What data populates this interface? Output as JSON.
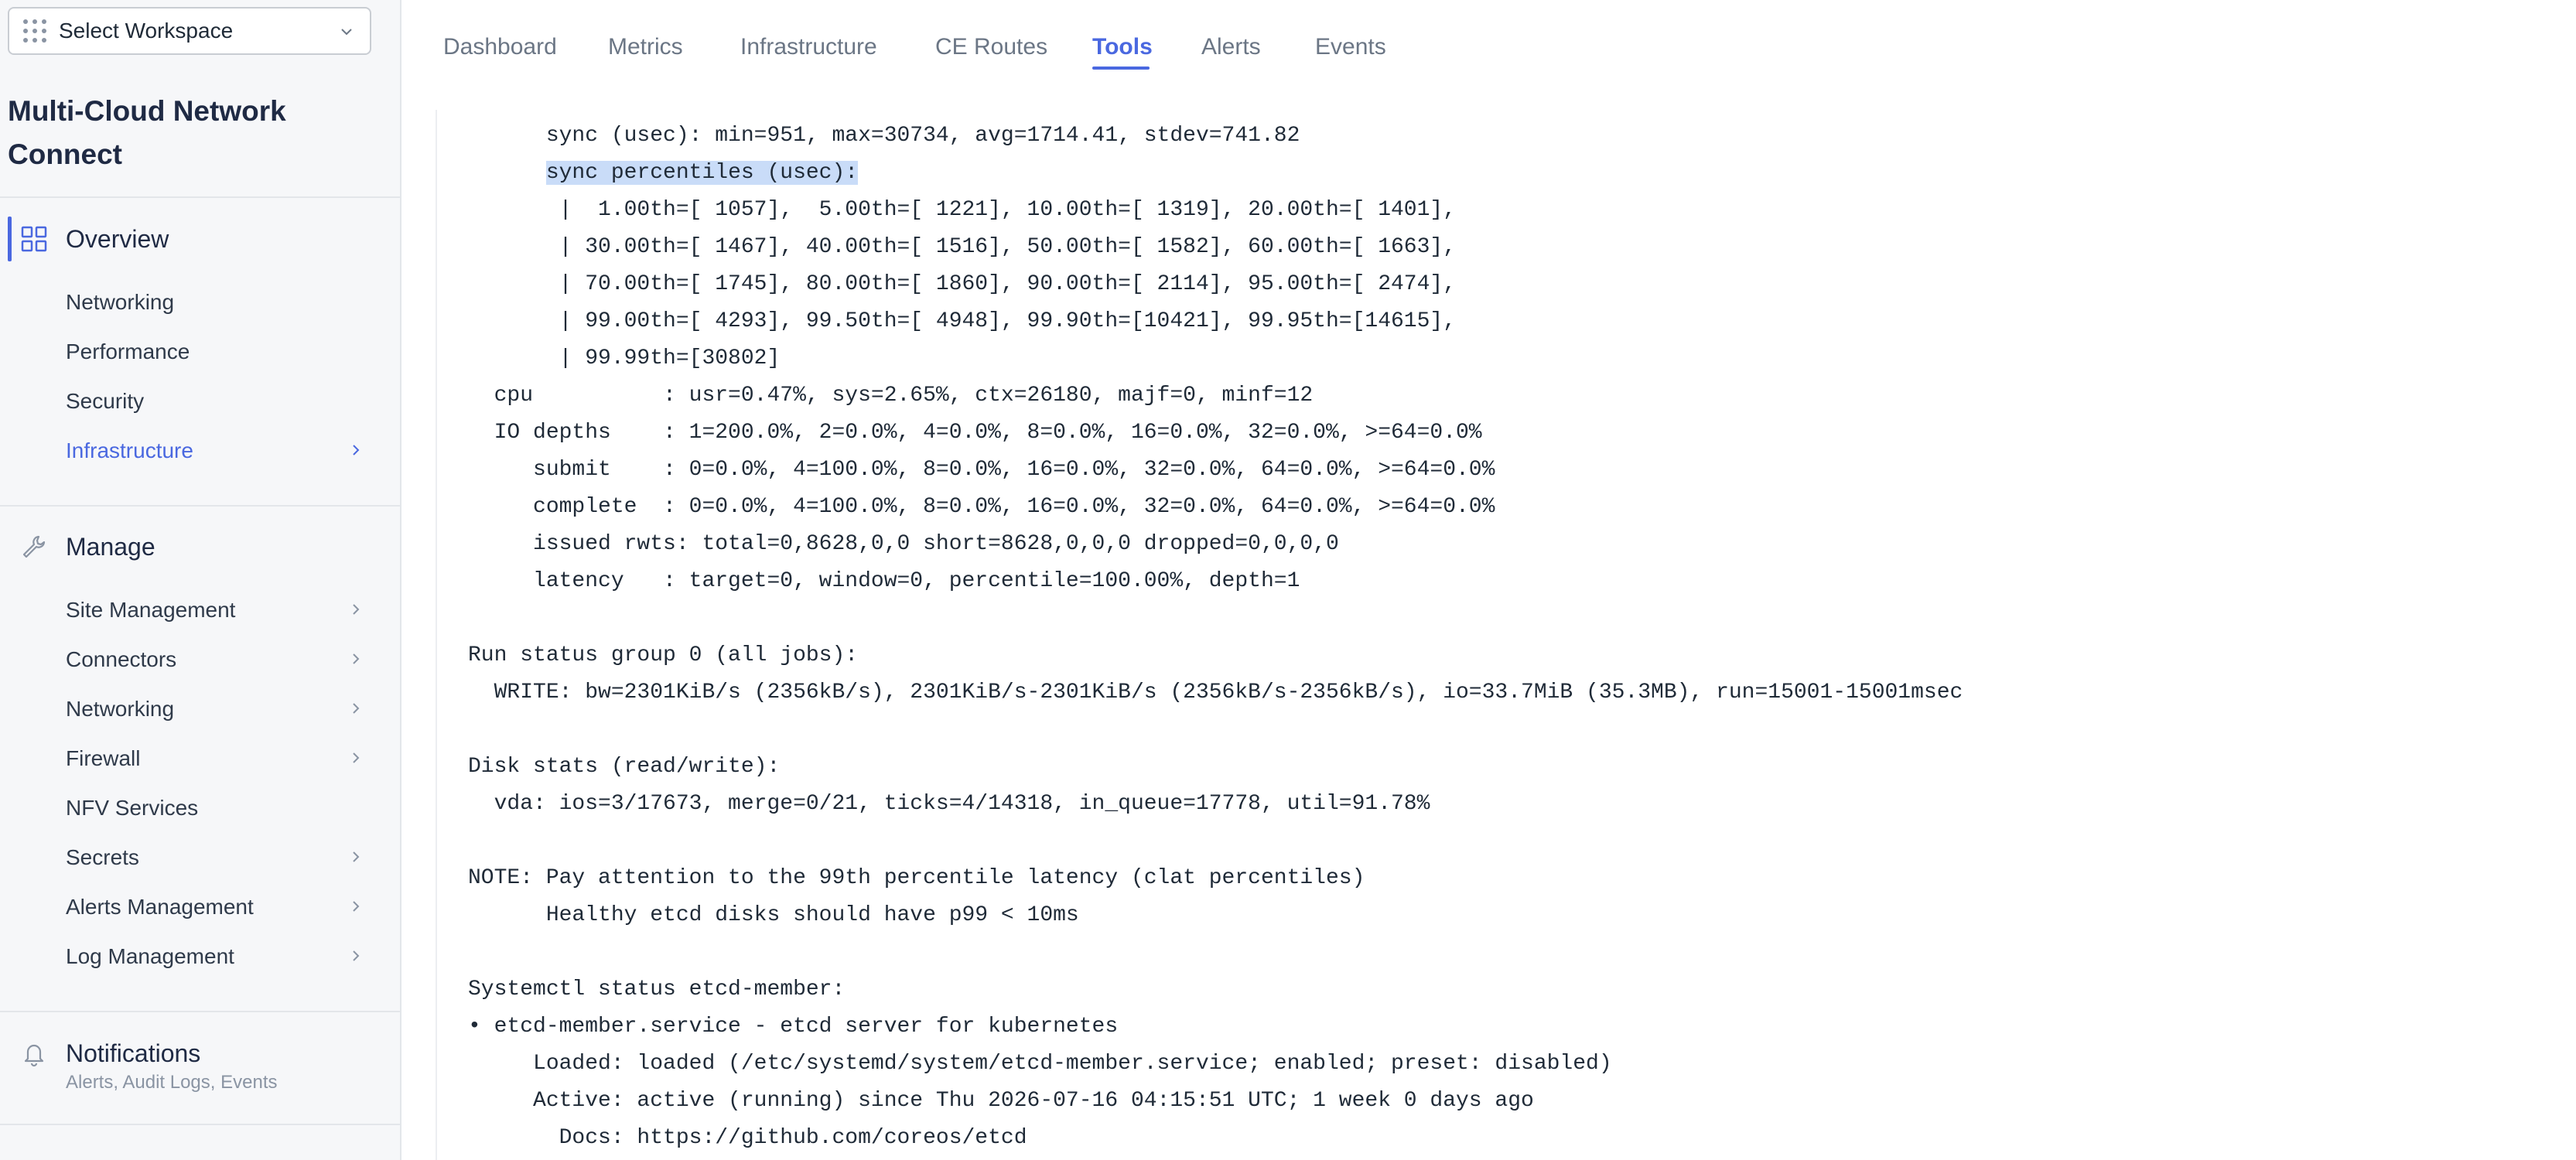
{
  "sidebar": {
    "workspace_select": {
      "label": "Select Workspace",
      "icon": "grid-icon"
    },
    "app_title": "Multi-Cloud Network Connect",
    "overview": {
      "label": "Overview",
      "items": [
        {
          "label": "Networking",
          "has_caret": false
        },
        {
          "label": "Performance",
          "has_caret": false
        },
        {
          "label": "Security",
          "has_caret": false
        },
        {
          "label": "Infrastructure",
          "has_caret": true,
          "highlighted": true
        }
      ]
    },
    "manage": {
      "label": "Manage",
      "items": [
        {
          "label": "Site Management",
          "has_caret": true
        },
        {
          "label": "Connectors",
          "has_caret": true
        },
        {
          "label": "Networking",
          "has_caret": true
        },
        {
          "label": "Firewall",
          "has_caret": true
        },
        {
          "label": "NFV Services",
          "has_caret": false
        },
        {
          "label": "Secrets",
          "has_caret": true
        },
        {
          "label": "Alerts Management",
          "has_caret": true
        },
        {
          "label": "Log Management",
          "has_caret": true
        }
      ]
    },
    "notifications": {
      "label": "Notifications",
      "sub": "Alerts, Audit Logs, Events"
    }
  },
  "tabs": [
    {
      "label": "Dashboard",
      "active": false
    },
    {
      "label": "Metrics",
      "active": false
    },
    {
      "label": "Infrastructure",
      "active": false
    },
    {
      "label": "CE Routes",
      "active": false
    },
    {
      "label": "Tools",
      "active": true
    },
    {
      "label": "Alerts",
      "active": false
    },
    {
      "label": "Events",
      "active": false
    }
  ],
  "terminal": {
    "lines": [
      "      sync (usec): min=951, max=30734, avg=1714.41, stdev=741.82",
      "      sync percentiles (usec):",
      "       |  1.00th=[ 1057],  5.00th=[ 1221], 10.00th=[ 1319], 20.00th=[ 1401],",
      "       | 30.00th=[ 1467], 40.00th=[ 1516], 50.00th=[ 1582], 60.00th=[ 1663],",
      "       | 70.00th=[ 1745], 80.00th=[ 1860], 90.00th=[ 2114], 95.00th=[ 2474],",
      "       | 99.00th=[ 4293], 99.50th=[ 4948], 99.90th=[10421], 99.95th=[14615],",
      "       | 99.99th=[30802]",
      "  cpu          : usr=0.47%, sys=2.65%, ctx=26180, majf=0, minf=12",
      "  IO depths    : 1=200.0%, 2=0.0%, 4=0.0%, 8=0.0%, 16=0.0%, 32=0.0%, >=64=0.0%",
      "     submit    : 0=0.0%, 4=100.0%, 8=0.0%, 16=0.0%, 32=0.0%, 64=0.0%, >=64=0.0%",
      "     complete  : 0=0.0%, 4=100.0%, 8=0.0%, 16=0.0%, 32=0.0%, 64=0.0%, >=64=0.0%",
      "     issued rwts: total=0,8628,0,0 short=8628,0,0,0 dropped=0,0,0,0",
      "     latency   : target=0, window=0, percentile=100.00%, depth=1",
      "",
      "Run status group 0 (all jobs):",
      "  WRITE: bw=2301KiB/s (2356kB/s), 2301KiB/s-2301KiB/s (2356kB/s-2356kB/s), io=33.7MiB (35.3MB), run=15001-15001msec",
      "",
      "Disk stats (read/write):",
      "  vda: ios=3/17673, merge=0/21, ticks=4/14318, in_queue=17778, util=91.78%",
      "",
      "NOTE: Pay attention to the 99th percentile latency (clat percentiles)",
      "      Healthy etcd disks should have p99 < 10ms",
      "",
      "Systemctl status etcd-member:",
      "• etcd-member.service - etcd server for kubernetes",
      "     Loaded: loaded (/etc/systemd/system/etcd-member.service; enabled; preset: disabled)",
      "     Active: active (running) since Thu 2026-07-16 04:15:51 UTC; 1 week 0 days ago",
      "       Docs: https://github.com/coreos/etcd"
    ],
    "highlighted_line": 1,
    "highlight_color": "#c9dcf8"
  },
  "colors": {
    "accent": "#4a68e0",
    "sidebar_bg": "#f6f7f9",
    "text": "#1f2a37"
  }
}
